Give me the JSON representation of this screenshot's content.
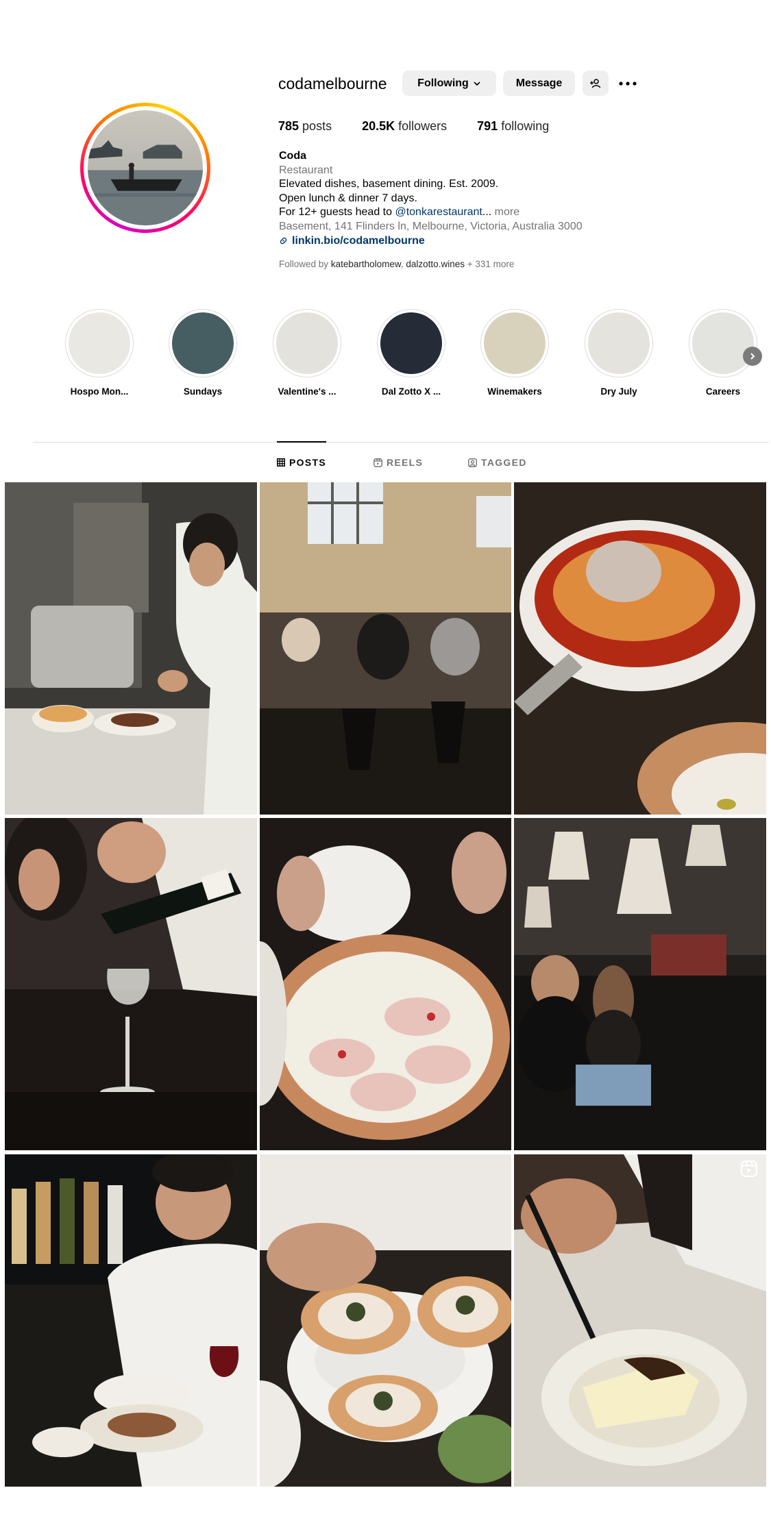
{
  "profile": {
    "username": "codamelbourne",
    "following_label": "Following",
    "message_label": "Message",
    "posts_count": "785",
    "posts_label": "posts",
    "followers_count": "20.5K",
    "followers_label": "followers",
    "following_count": "791",
    "following_stat_label": "following",
    "name": "Coda",
    "category": "Restaurant",
    "bio_line1": "Elevated dishes, basement dining. Est. 2009.",
    "bio_line2": "Open lunch & dinner 7 days.",
    "bio_line3_prefix": "For 12+ guests head to",
    "bio_line3_mention": "@tonkarestaurant",
    "bio_line3_ellipsis": "...",
    "bio_more": "more",
    "address": "Basement, 141 Flinders ln, Melbourne, Victoria, Australia 3000",
    "link": "linkin.bio/codamelbourne",
    "followed_prefix": "Followed by",
    "followed_user1": "katebartholomew",
    "followed_sep": ",",
    "followed_user2": "dalzotto.wines",
    "followed_more": "+ 331 more"
  },
  "highlights": [
    {
      "label": "Hospo Mon...",
      "color": "#e9e8e3"
    },
    {
      "label": "Sundays",
      "color": "#465e62"
    },
    {
      "label": "Valentine's ...",
      "color": "#e3e2dc"
    },
    {
      "label": "Dal Zotto X ...",
      "color": "#252c37"
    },
    {
      "label": "Winemakers",
      "color": "#d8d2bc"
    },
    {
      "label": "Dry July",
      "color": "#e4e3dd"
    },
    {
      "label": "Careers",
      "color": "#e3e3df"
    }
  ],
  "tabs": {
    "posts": "POSTS",
    "reels": "REELS",
    "tagged": "TAGGED"
  },
  "icons": {
    "following_chevron": "chevron-down-icon",
    "add_user": "add-user-icon",
    "more": "more-options-icon",
    "link": "link-icon",
    "highlights_next": "chevron-right-icon",
    "posts_tab": "grid-icon",
    "reels_tab": "reels-icon",
    "tagged_tab": "tag-icon",
    "reel_badge": "reel-icon"
  },
  "colors": {
    "link_blue": "#00376b",
    "muted_text": "#737373",
    "button_bg": "#efefef",
    "story_ring_start": "#d300c5",
    "story_ring_end": "#ffd600"
  }
}
